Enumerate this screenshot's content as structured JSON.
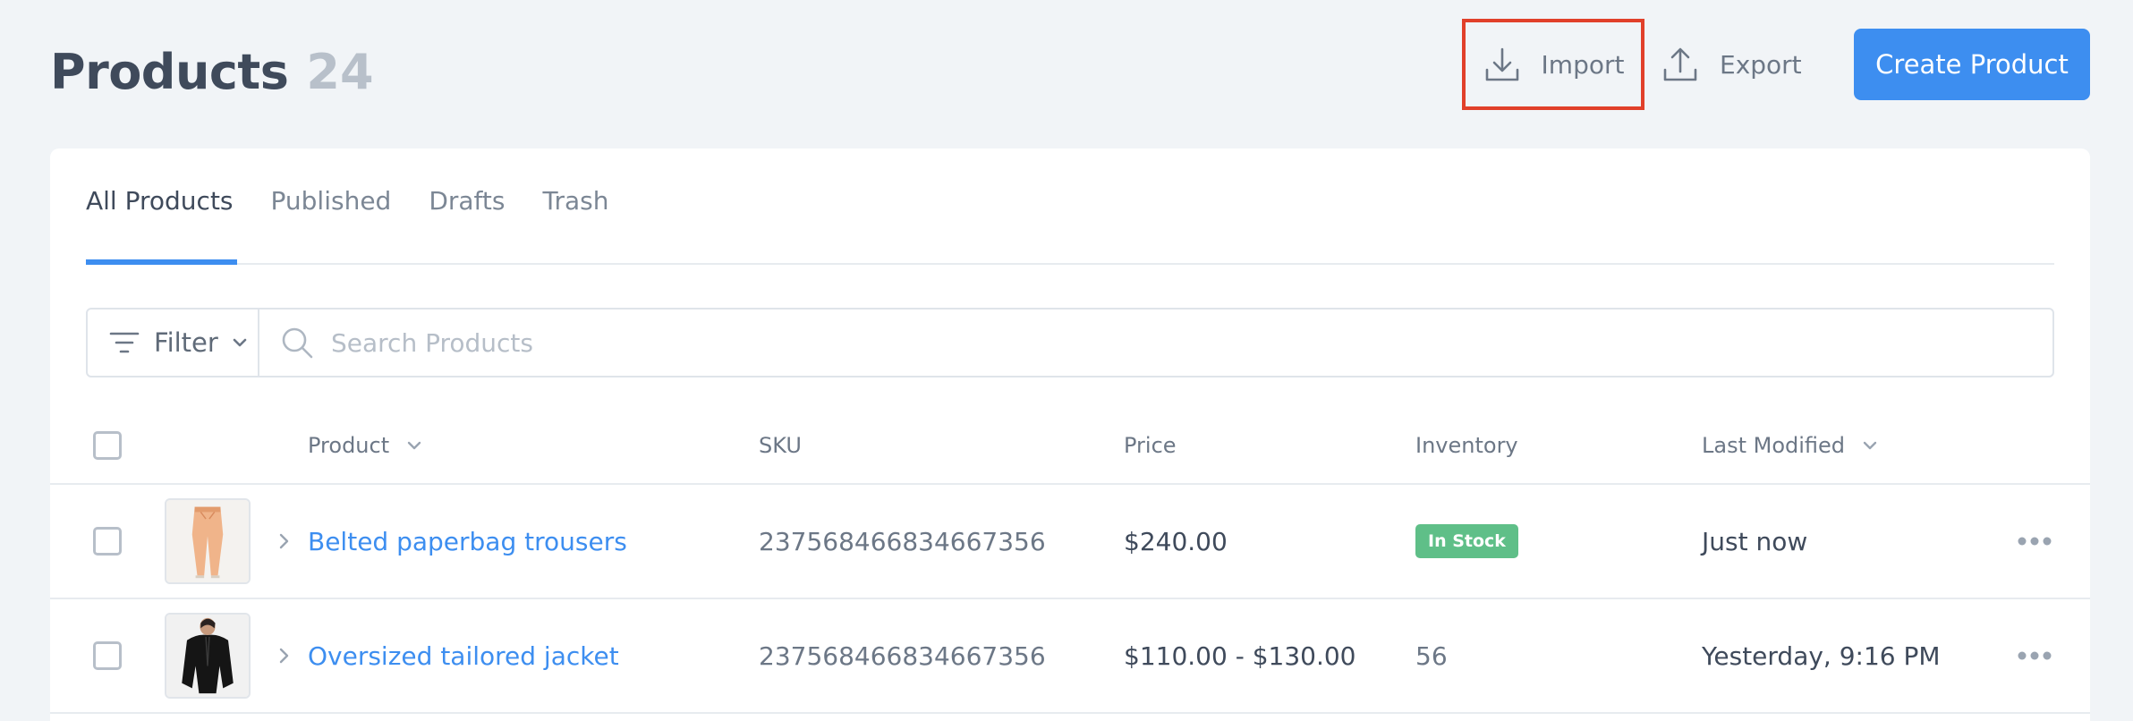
{
  "header": {
    "title": "Products",
    "count": "24",
    "import_label": "Import",
    "export_label": "Export",
    "create_label": "Create Product"
  },
  "tabs": [
    {
      "label": "All Products",
      "active": true
    },
    {
      "label": "Published",
      "active": false
    },
    {
      "label": "Drafts",
      "active": false
    },
    {
      "label": "Trash",
      "active": false
    }
  ],
  "toolbar": {
    "filter_label": "Filter",
    "search_placeholder": "Search Products",
    "search_value": ""
  },
  "table": {
    "columns": {
      "product": "Product",
      "sku": "SKU",
      "price": "Price",
      "inventory": "Inventory",
      "last_modified": "Last Modified"
    },
    "rows": [
      {
        "name": "Belted paperbag trousers",
        "sku": "237568466834667356",
        "price": "$240.00",
        "inventory": "In Stock",
        "modified": "Just now"
      },
      {
        "name": "Oversized tailored jacket",
        "sku": "237568466834667356",
        "price": "$110.00 - $130.00",
        "inventory": "56",
        "modified": "Yesterday, 9:16 PM"
      }
    ]
  },
  "colors": {
    "accent": "#3d8ef0",
    "highlight": "#e1402a",
    "in_stock": "#5fbf88"
  }
}
